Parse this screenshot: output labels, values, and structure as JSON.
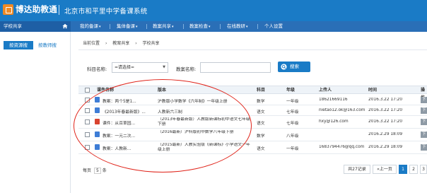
{
  "header": {
    "logo_text": "博达助教通",
    "system_title": "北京市和平里中学备课系统"
  },
  "nav": {
    "left_label": "学校共享",
    "items": [
      {
        "label": "我的备课",
        "caret": "▾"
      },
      {
        "label": "集体备课",
        "caret": "▾"
      },
      {
        "label": "教案共享",
        "caret": "▾"
      },
      {
        "label": "教案检查",
        "caret": "▾"
      },
      {
        "label": "在线教研",
        "caret": "▾"
      },
      {
        "label": "个人设置",
        "caret": ""
      }
    ]
  },
  "sidebar": {
    "active_button": "按资源搜",
    "other_button": "按教师搜"
  },
  "breadcrumb": [
    "当前位置",
    "教案共享",
    "学校共享"
  ],
  "filters": {
    "subject_label": "科目名称:",
    "subject_value": "=请选择=",
    "lesson_label": "教案名称:",
    "lesson_placeholder": "",
    "search_button": "搜索"
  },
  "table": {
    "headers": [
      "课件名称",
      "版本",
      "科目",
      "年级",
      "上传人",
      "时间",
      "操作"
    ],
    "rows": [
      {
        "name": "教案：两个5是1...",
        "version": "沪教版小学数学《六年制》一年级上册",
        "subject": "数学",
        "grade": "一年级",
        "uploader": "18621669116",
        "time": "2016.3.22 17:20",
        "icon": "word",
        "action": "下"
      },
      {
        "name": "《2013年春最新版》...",
        "version": "人教新六三制",
        "subject": "语文",
        "grade": "七年级",
        "uploader": "nietao12.ok@163.com",
        "time": "2016.3.22 17:20",
        "icon": "word",
        "action": "下"
      },
      {
        "name": "课件：从百草园...",
        "version": "（2013年春最新版）人教版新课标初中语文七年级下册",
        "subject": "语文",
        "grade": "七年级",
        "uploader": "hxy@126.com",
        "time": "2016.3.22 17:20",
        "icon": "pdf",
        "action": "下"
      },
      {
        "name": "教案：一元二次...",
        "version": "（2016最新）沪科版初中数学八年级下册",
        "subject": "数学",
        "grade": "八年级",
        "uploader": "",
        "time": "2016.2.29 18:09",
        "icon": "word",
        "action": "下"
      },
      {
        "name": "教案：人教新...",
        "version": "（2015最新）人教实验版《新课标》小学语文一年级上册",
        "subject": "语文",
        "grade": "一年级",
        "uploader": "1683794476@qq.com",
        "time": "2016.2.29 18:09",
        "icon": "word",
        "action": "下"
      }
    ]
  },
  "pagination": {
    "per_page_label": "每页",
    "per_page_value": "5",
    "per_page_unit": "条",
    "total": "共27记录",
    "prev": "«上一页",
    "pages": [
      "1",
      "2",
      "3"
    ],
    "active_page": "1"
  },
  "colors": {
    "header_blue": "#1a7bc6",
    "annotation_red": "#e0251b",
    "logo_orange": "#f08a24"
  }
}
